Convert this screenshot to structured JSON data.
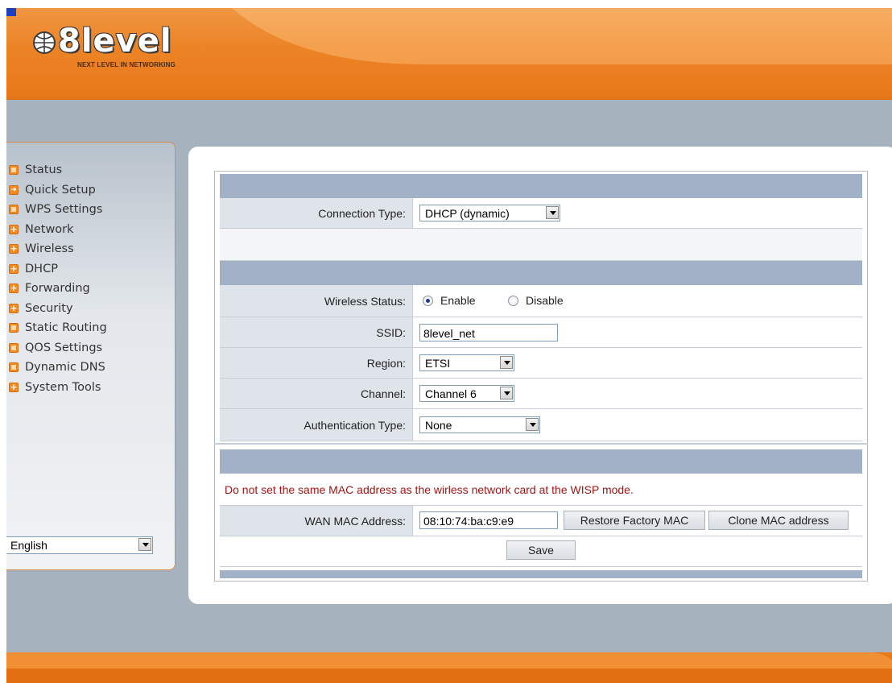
{
  "brand": {
    "logo_text": "8level",
    "tagline": "NEXT LEVEL IN NETWORKING"
  },
  "sidebar": {
    "items": [
      {
        "label": "Status",
        "icon": "square-icon"
      },
      {
        "label": "Quick Setup",
        "icon": "arrow-icon"
      },
      {
        "label": "WPS Settings",
        "icon": "square-icon"
      },
      {
        "label": "Network",
        "icon": "plus-icon"
      },
      {
        "label": "Wireless",
        "icon": "plus-icon"
      },
      {
        "label": "DHCP",
        "icon": "plus-icon"
      },
      {
        "label": "Forwarding",
        "icon": "plus-icon"
      },
      {
        "label": "Security",
        "icon": "plus-icon"
      },
      {
        "label": "Static Routing",
        "icon": "square-icon"
      },
      {
        "label": "QOS Settings",
        "icon": "square-icon"
      },
      {
        "label": "Dynamic DNS",
        "icon": "square-icon"
      },
      {
        "label": "System Tools",
        "icon": "plus-icon"
      }
    ],
    "language": "English"
  },
  "form": {
    "connection_type": {
      "label": "Connection Type:",
      "value": "DHCP (dynamic)"
    },
    "wireless_status": {
      "label": "Wireless Status:",
      "enable": "Enable",
      "disable": "Disable",
      "selected": "Enable"
    },
    "ssid": {
      "label": "SSID:",
      "value": "8level_net"
    },
    "region": {
      "label": "Region:",
      "value": "ETSI"
    },
    "channel": {
      "label": "Channel:",
      "value": "Channel 6"
    },
    "auth_type": {
      "label": "Authentication Type:",
      "value": "None"
    },
    "warning": "Do not set the same MAC address as the wirless network card at the WISP mode.",
    "wan_mac": {
      "label": "WAN MAC Address:",
      "value": "08:10:74:ba:c9:e9",
      "restore_btn": "Restore Factory MAC",
      "clone_btn": "Clone MAC address"
    },
    "save_btn": "Save"
  },
  "colors": {
    "header_orange": "#ee8a2c",
    "band_blue": "#a2b1c5",
    "label_cell": "#dfe4ea",
    "warning_red": "#a31515",
    "background": "#a7b2bf"
  }
}
